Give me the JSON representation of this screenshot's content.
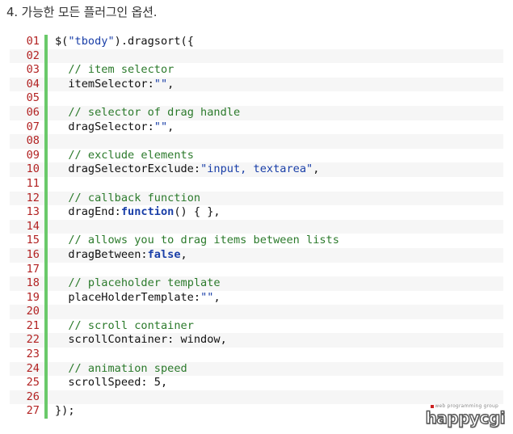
{
  "heading": "4. 가능한 모든 플러그인 옵션.",
  "code_lines": [
    {
      "num": "01",
      "tokens": [
        {
          "t": "plain",
          "v": "$("
        },
        {
          "t": "string",
          "v": "\"tbody\""
        },
        {
          "t": "plain",
          "v": ").dragsort({"
        }
      ]
    },
    {
      "num": "02",
      "tokens": []
    },
    {
      "num": "03",
      "tokens": [
        {
          "t": "plain",
          "v": "  "
        },
        {
          "t": "comment",
          "v": "// item selector"
        }
      ]
    },
    {
      "num": "04",
      "tokens": [
        {
          "t": "plain",
          "v": "  itemSelector:"
        },
        {
          "t": "string",
          "v": "\"\""
        },
        {
          "t": "plain",
          "v": ","
        }
      ]
    },
    {
      "num": "05",
      "tokens": []
    },
    {
      "num": "06",
      "tokens": [
        {
          "t": "plain",
          "v": "  "
        },
        {
          "t": "comment",
          "v": "// selector of drag handle"
        }
      ]
    },
    {
      "num": "07",
      "tokens": [
        {
          "t": "plain",
          "v": "  dragSelector:"
        },
        {
          "t": "string",
          "v": "\"\""
        },
        {
          "t": "plain",
          "v": ","
        }
      ]
    },
    {
      "num": "08",
      "tokens": []
    },
    {
      "num": "09",
      "tokens": [
        {
          "t": "plain",
          "v": "  "
        },
        {
          "t": "comment",
          "v": "// exclude elements"
        }
      ]
    },
    {
      "num": "10",
      "tokens": [
        {
          "t": "plain",
          "v": "  dragSelectorExclude:"
        },
        {
          "t": "string",
          "v": "\"input, textarea\""
        },
        {
          "t": "plain",
          "v": ","
        }
      ]
    },
    {
      "num": "11",
      "tokens": []
    },
    {
      "num": "12",
      "tokens": [
        {
          "t": "plain",
          "v": "  "
        },
        {
          "t": "comment",
          "v": "// callback function"
        }
      ]
    },
    {
      "num": "13",
      "tokens": [
        {
          "t": "plain",
          "v": "  dragEnd:"
        },
        {
          "t": "keyword",
          "v": "function"
        },
        {
          "t": "plain",
          "v": "() { },"
        }
      ]
    },
    {
      "num": "14",
      "tokens": []
    },
    {
      "num": "15",
      "tokens": [
        {
          "t": "plain",
          "v": "  "
        },
        {
          "t": "comment",
          "v": "// allows you to drag items between lists"
        }
      ]
    },
    {
      "num": "16",
      "tokens": [
        {
          "t": "plain",
          "v": "  dragBetween:"
        },
        {
          "t": "keyword",
          "v": "false"
        },
        {
          "t": "plain",
          "v": ","
        }
      ]
    },
    {
      "num": "17",
      "tokens": []
    },
    {
      "num": "18",
      "tokens": [
        {
          "t": "plain",
          "v": "  "
        },
        {
          "t": "comment",
          "v": "// placeholder template"
        }
      ]
    },
    {
      "num": "19",
      "tokens": [
        {
          "t": "plain",
          "v": "  placeHolderTemplate:"
        },
        {
          "t": "string",
          "v": "\"\""
        },
        {
          "t": "plain",
          "v": ","
        }
      ]
    },
    {
      "num": "20",
      "tokens": []
    },
    {
      "num": "21",
      "tokens": [
        {
          "t": "plain",
          "v": "  "
        },
        {
          "t": "comment",
          "v": "// scroll container"
        }
      ]
    },
    {
      "num": "22",
      "tokens": [
        {
          "t": "plain",
          "v": "  scrollContainer: window,"
        }
      ]
    },
    {
      "num": "23",
      "tokens": []
    },
    {
      "num": "24",
      "tokens": [
        {
          "t": "plain",
          "v": "  "
        },
        {
          "t": "comment",
          "v": "// animation speed"
        }
      ]
    },
    {
      "num": "25",
      "tokens": [
        {
          "t": "plain",
          "v": "  scrollSpeed: 5,"
        }
      ]
    },
    {
      "num": "26",
      "tokens": []
    },
    {
      "num": "27",
      "tokens": [
        {
          "t": "plain",
          "v": "});"
        }
      ]
    }
  ],
  "logo": {
    "subtitle": "web programming group",
    "name": "happycgi"
  },
  "colors": {
    "line_number": "#b22222",
    "gutter_bar": "#6ac96a",
    "comment": "#2b7a2b",
    "string": "#1a3fa8",
    "keyword": "#1a3fa8",
    "alt_row": "#f6f6f6"
  }
}
